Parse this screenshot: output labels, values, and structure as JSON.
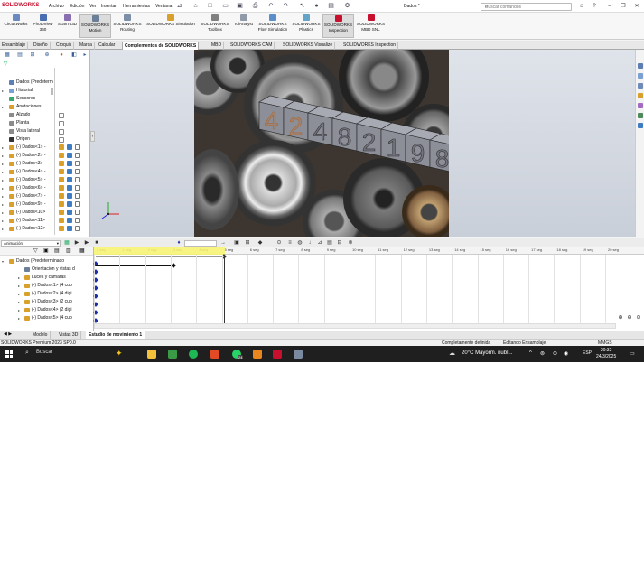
{
  "app": {
    "logo": "SOLIDWORKS",
    "document_title": "Dados *"
  },
  "menu": [
    "Archivo",
    "Edición",
    "Ver",
    "Insertar",
    "Herramientas",
    "Ventana"
  ],
  "search": {
    "placeholder": "Buscar comandos"
  },
  "ribbon": [
    {
      "label": "CircuitWorks",
      "label2": ""
    },
    {
      "label": "PhotoView",
      "label2": "360"
    },
    {
      "label": "ScanTo3D",
      "label2": ""
    },
    {
      "label": "SOLIDWORKS",
      "label2": "Motion"
    },
    {
      "label": "SOLIDWORKS",
      "label2": "Routing"
    },
    {
      "label": "SOLIDWORKS Simulation",
      "label2": ""
    },
    {
      "label": "SOLIDWORKS",
      "label2": "Toolbox"
    },
    {
      "label": "TolAnalyst",
      "label2": ""
    },
    {
      "label": "SOLIDWORKS",
      "label2": "Flow Simulation"
    },
    {
      "label": "SOLIDWORKS",
      "label2": "Plastics"
    },
    {
      "label": "SOLIDWORKS",
      "label2": "Inspection"
    },
    {
      "label": "SOLIDWORKS",
      "label2": "MBD SNL"
    }
  ],
  "tabs": [
    "Ensamblaje",
    "Diseño",
    "Croquis",
    "Marca",
    "Calcular",
    "Complementos de SOLIDWORKS",
    "MBD",
    "SOLIDWORKS CAM",
    "SOLIDWORKS Visualize",
    "SOLIDWORKS Inspection"
  ],
  "tree": [
    {
      "label": "Dados  (Predeterm",
      "exp": ""
    },
    {
      "label": "Historial",
      "exp": "▸"
    },
    {
      "label": "Sensores",
      "exp": ""
    },
    {
      "label": "Anotaciones",
      "exp": "▸"
    },
    {
      "label": "Alzado",
      "exp": ""
    },
    {
      "label": "Planta",
      "exp": ""
    },
    {
      "label": "Vista lateral",
      "exp": ""
    },
    {
      "label": "Origen",
      "exp": ""
    },
    {
      "label": "(-) Dados<1> -",
      "exp": "▸"
    },
    {
      "label": "(-) Dados<2> -",
      "exp": "▸"
    },
    {
      "label": "(-) Dados<3> -",
      "exp": "▸"
    },
    {
      "label": "(-) Dados<4> -",
      "exp": "▸"
    },
    {
      "label": "(-) Dados<5> -",
      "exp": "▸"
    },
    {
      "label": "(-) Dados<6> -",
      "exp": "▸"
    },
    {
      "label": "(-) Dados<7> -",
      "exp": "▸"
    },
    {
      "label": "(-) Dados<9> -",
      "exp": "▸"
    },
    {
      "label": "(-) Dados<10>",
      "exp": "▸"
    },
    {
      "label": "(-) Dados<11>",
      "exp": "▸"
    },
    {
      "label": "(-) Dados<12>",
      "exp": "▸"
    }
  ],
  "viewport": {
    "digits": [
      "4",
      "2",
      "4",
      "8",
      "2",
      "1",
      "9",
      "8"
    ]
  },
  "animation": {
    "study_type": "Animación"
  },
  "timeline": {
    "ticks": [
      "0 seg",
      "1 seg",
      "2 seg",
      "3 seg",
      "4 seg",
      "5 seg",
      "6 seg",
      "7 seg",
      "8 seg",
      "9 seg",
      "10 seg",
      "11 seg",
      "12 seg",
      "13 seg",
      "14 seg",
      "15 seg",
      "16 seg",
      "17 seg",
      "18 seg",
      "19 seg",
      "20 seg"
    ],
    "rows": [
      {
        "label": "Dados (Predeterminado",
        "exp": "▾"
      },
      {
        "label": "Orientación y vistas d",
        "exp": ""
      },
      {
        "label": "Luces y cámaras",
        "exp": "▸"
      },
      {
        "label": "(-) Dados<1> (4 cub",
        "exp": "▸"
      },
      {
        "label": "(-) Dados<2> (4 digi",
        "exp": "▸"
      },
      {
        "label": "(-) Dados<3> (2 cub",
        "exp": "▸"
      },
      {
        "label": "(-) Dados<4> (2 digi",
        "exp": "▸"
      },
      {
        "label": "(-) Dados<5> (4 cub",
        "exp": "▸"
      }
    ]
  },
  "bottom_tabs": [
    "Modelo",
    "Vistas 3D",
    "Estudio de movimiento 1"
  ],
  "status": {
    "left": "SOLIDWORKS Premium 2023 SP0.0",
    "state": "Completamente definida",
    "mode": "Editando Ensamblaje",
    "units": "MMGS"
  },
  "taskbar": {
    "search": "Buscar",
    "weather": "20°C  Mayorm. nubl...",
    "lang": "ESP",
    "time": "20:32",
    "date": "24/3/2025",
    "badge": "24"
  },
  "colors": {
    "accent": "#c8102e",
    "keyframe": "#1b2fa8",
    "timebar": "#f7f36d"
  }
}
